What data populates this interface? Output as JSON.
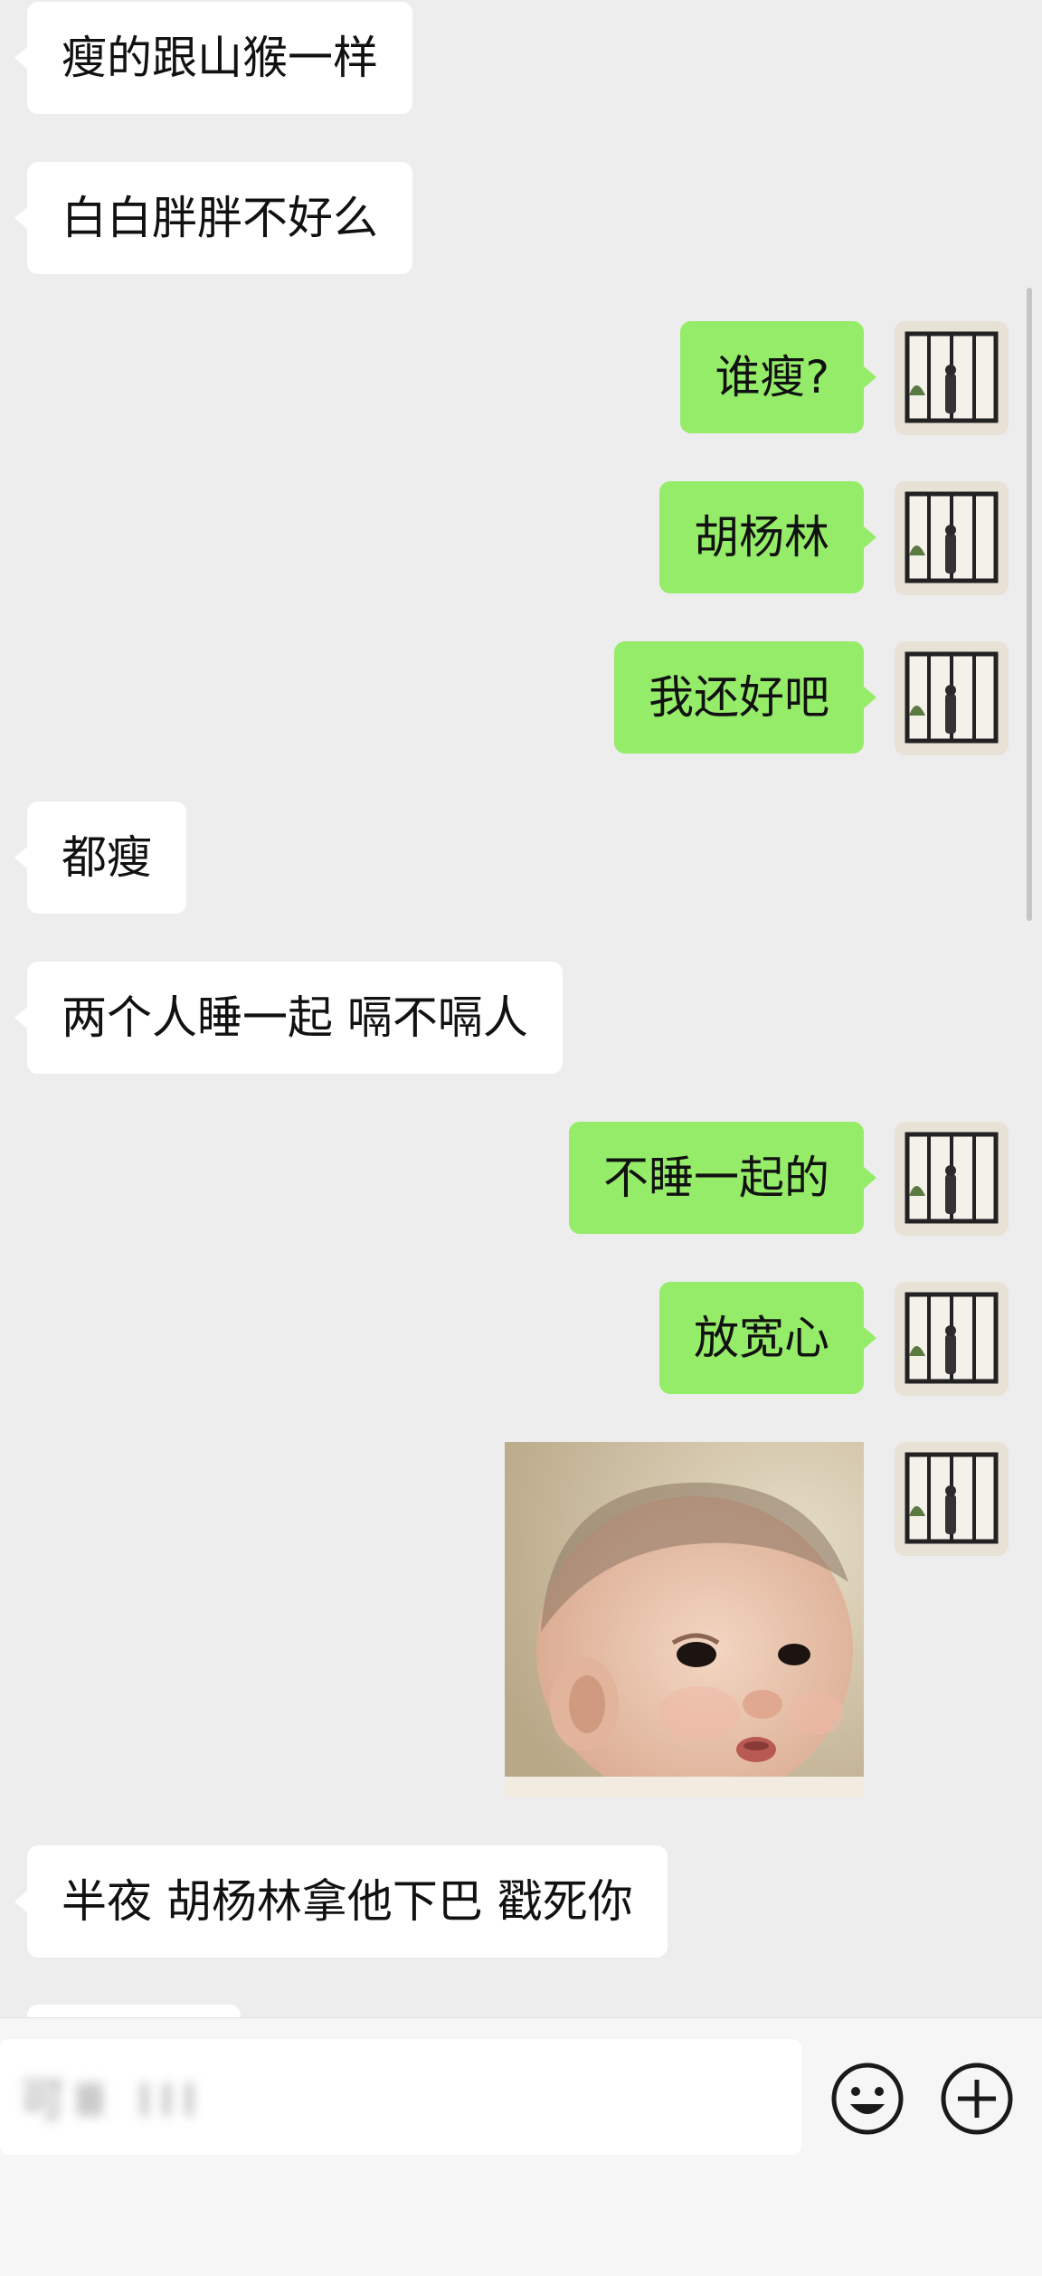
{
  "messages": [
    {
      "from": "peer",
      "text": "瘦的跟山猴一样"
    },
    {
      "from": "peer",
      "text": "白白胖胖不好么"
    },
    {
      "from": "me",
      "text": "谁瘦?"
    },
    {
      "from": "me",
      "text": "胡杨林"
    },
    {
      "from": "me",
      "text": "我还好吧"
    },
    {
      "from": "peer",
      "text": "都瘦"
    },
    {
      "from": "peer",
      "text": "两个人睡一起 嗝不嗝人"
    },
    {
      "from": "me",
      "text": "不睡一起的"
    },
    {
      "from": "me",
      "text": "放宽心"
    },
    {
      "from": "me",
      "type": "image",
      "icon": "baby-photo"
    },
    {
      "from": "peer",
      "text": "半夜 胡杨林拿他下巴 戳死你"
    }
  ],
  "input": {
    "draft_text": "可Ⅲ      ⅠⅠⅠ",
    "emoji_icon": "smiley-face-icon",
    "more_icon": "plus-circle-icon"
  },
  "colors": {
    "background": "#ededed",
    "incoming_bubble": "#ffffff",
    "outgoing_bubble": "#95ec69"
  }
}
